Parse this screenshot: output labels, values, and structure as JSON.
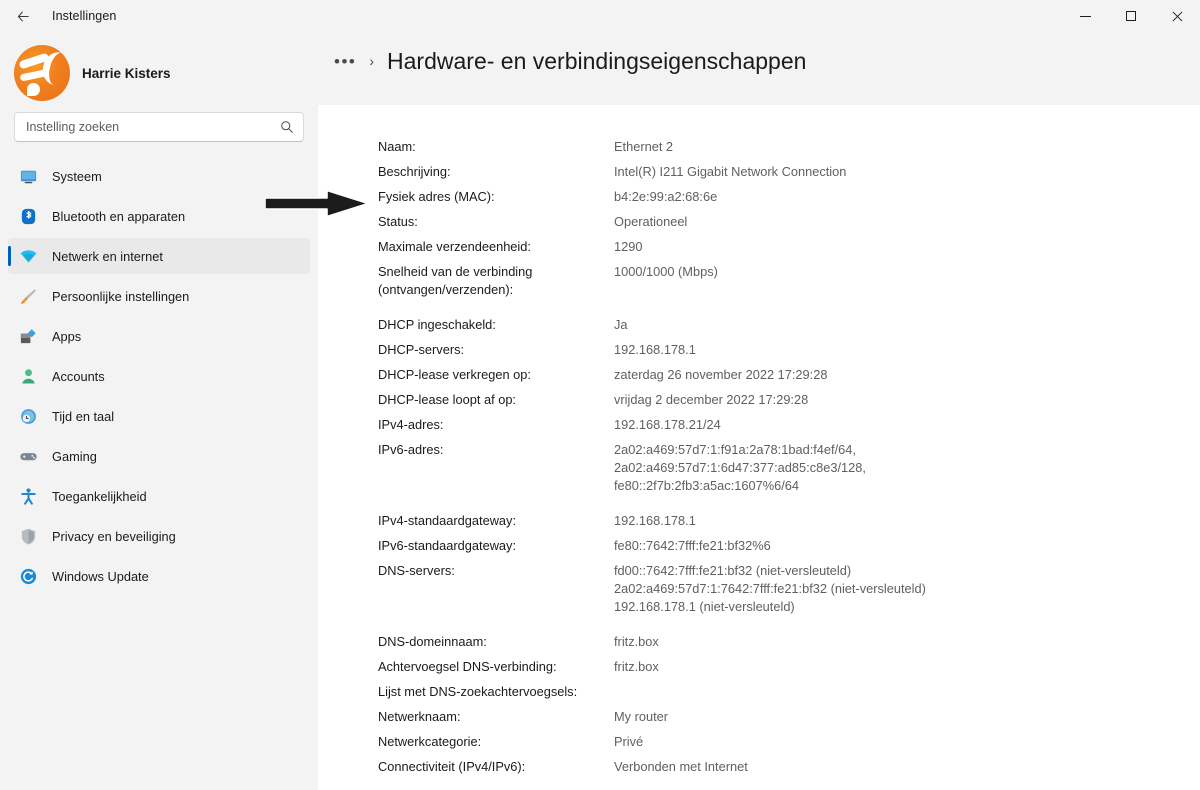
{
  "window": {
    "title": "Instellingen",
    "back_icon": "back-arrow-icon",
    "minimize_label": "Minimaliseren",
    "maximize_label": "Maximaliseren",
    "close_label": "Sluiten"
  },
  "sidebar": {
    "profile": {
      "name": "Harrie Kisters",
      "avatar_icon": "user-avatar-logo"
    },
    "search": {
      "placeholder": "Instelling zoeken",
      "value": "",
      "icon": "search-icon"
    },
    "items": [
      {
        "label": "Systeem",
        "icon": "monitor-icon",
        "selected": false
      },
      {
        "label": "Bluetooth en apparaten",
        "icon": "bluetooth-icon",
        "selected": false
      },
      {
        "label": "Netwerk en internet",
        "icon": "wifi-icon",
        "selected": true
      },
      {
        "label": "Persoonlijke instellingen",
        "icon": "paintbrush-icon",
        "selected": false
      },
      {
        "label": "Apps",
        "icon": "apps-icon",
        "selected": false
      },
      {
        "label": "Accounts",
        "icon": "person-icon",
        "selected": false
      },
      {
        "label": "Tijd en taal",
        "icon": "clock-globe-icon",
        "selected": false
      },
      {
        "label": "Gaming",
        "icon": "gamepad-icon",
        "selected": false
      },
      {
        "label": "Toegankelijkheid",
        "icon": "accessibility-icon",
        "selected": false
      },
      {
        "label": "Privacy en beveiliging",
        "icon": "shield-icon",
        "selected": false
      },
      {
        "label": "Windows Update",
        "icon": "update-icon",
        "selected": false
      }
    ]
  },
  "content": {
    "breadcrumb": {
      "overflow": "•••",
      "separator": "›"
    },
    "page_title": "Hardware- en verbindingseigenschappen",
    "properties": [
      {
        "label": "Naam:",
        "value": "Ethernet 2"
      },
      {
        "label": "Beschrijving:",
        "value": "Intel(R) I211 Gigabit Network Connection"
      },
      {
        "label": "Fysiek adres (MAC):",
        "value": "b4:2e:99:a2:68:6e"
      },
      {
        "label": "Status:",
        "value": "Operationeel"
      },
      {
        "label": "Maximale verzendeenheid:",
        "value": "1290"
      },
      {
        "label": "Snelheid van de verbinding (ontvangen/verzenden):",
        "value": "1000/1000 (Mbps)"
      },
      {
        "label": "DHCP ingeschakeld:",
        "value": "Ja"
      },
      {
        "label": "DHCP-servers:",
        "value": "192.168.178.1"
      },
      {
        "label": "DHCP-lease verkregen op:",
        "value": "zaterdag 26 november 2022 17:29:28"
      },
      {
        "label": "DHCP-lease loopt af op:",
        "value": "vrijdag 2 december 2022 17:29:28"
      },
      {
        "label": "IPv4-adres:",
        "value": "192.168.178.21/24"
      },
      {
        "label": "IPv6-adres:",
        "value": "2a02:a469:57d7:1:f91a:2a78:1bad:f4ef/64,\n2a02:a469:57d7:1:6d47:377:ad85:c8e3/128,\nfe80::2f7b:2fb3:a5ac:1607%6/64"
      },
      {
        "label": "IPv4-standaardgateway:",
        "value": "192.168.178.1"
      },
      {
        "label": "IPv6-standaardgateway:",
        "value": "fe80::7642:7fff:fe21:bf32%6"
      },
      {
        "label": "DNS-servers:",
        "value": "fd00::7642:7fff:fe21:bf32 (niet-versleuteld)\n2a02:a469:57d7:1:7642:7fff:fe21:bf32 (niet-versleuteld)\n192.168.178.1 (niet-versleuteld)"
      },
      {
        "label": "DNS-domeinnaam:",
        "value": "fritz.box"
      },
      {
        "label": "Achtervoegsel DNS-verbinding:",
        "value": "fritz.box"
      },
      {
        "label": "Lijst met DNS-zoekachtervoegsels:",
        "value": ""
      },
      {
        "label": "Netwerknaam:",
        "value": "My router"
      },
      {
        "label": "Netwerkcategorie:",
        "value": "Privé"
      },
      {
        "label": "Connectiviteit (IPv4/IPv6):",
        "value": "Verbonden met Internet"
      }
    ]
  },
  "annotation": {
    "arrow_icon": "right-arrow-annotation",
    "points_at": "Fysiek adres (MAC):"
  },
  "colors": {
    "accent": "#005fb8",
    "window_bg": "#f3f3f3",
    "card_bg": "#ffffff",
    "label_text": "#1b1b1b",
    "value_text": "#606060",
    "selected_item_bg": "#e9e9e9",
    "avatar_orange": "#f07e1d"
  }
}
